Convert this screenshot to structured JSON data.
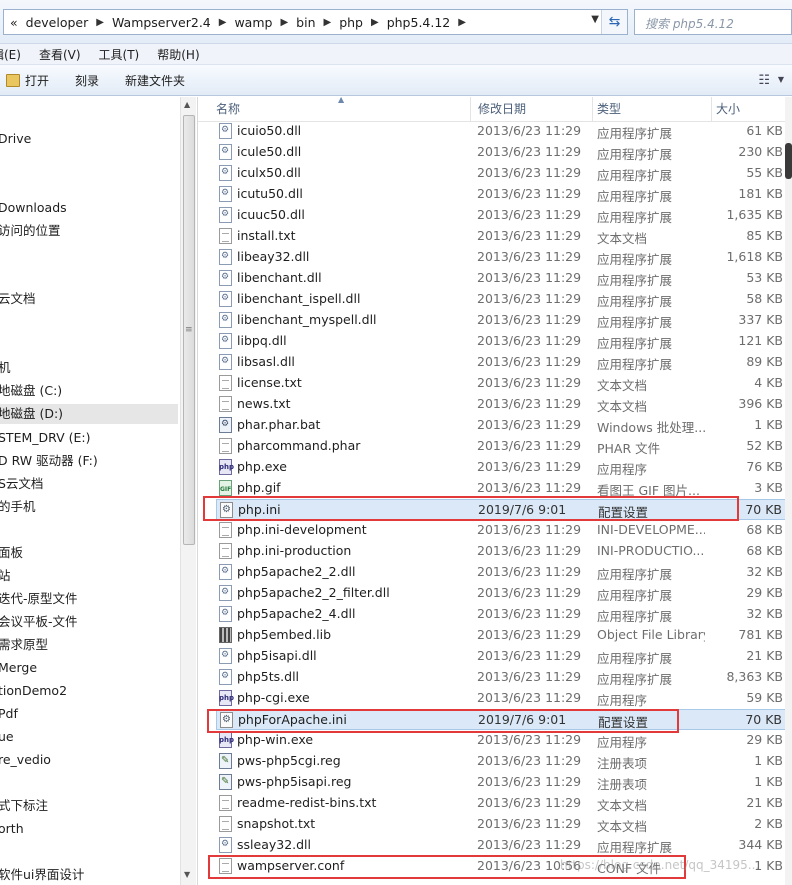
{
  "address_bar": {
    "crumbs": [
      "developer",
      "Wampserver2.4",
      "wamp",
      "bin",
      "php",
      "php5.4.12"
    ],
    "search_placeholder": "搜索 php5.4.12"
  },
  "menu": [
    "辑(E)",
    "查看(V)",
    "工具(T)",
    "帮助(H)"
  ],
  "toolbar": {
    "open": "打开",
    "burn": "刻录",
    "new_folder": "新建文件夹"
  },
  "nav_items": [
    "Drive",
    "Downloads",
    "访问的位置",
    "云文档",
    "机",
    "地磁盘 (C:)",
    "地磁盘 (D:)",
    "STEM_DRV (E:)",
    "D RW 驱动器 (F:)",
    "S云文档",
    "的手机",
    "面板",
    "站",
    "迭代-原型文件",
    "会议平板-文件",
    "需求原型",
    "Merge",
    "tionDemo2",
    "Pdf",
    "ue",
    "re_vedio",
    "式下标注",
    "orth",
    "软件ui界面设计"
  ],
  "columns": {
    "name": "名称",
    "date": "修改日期",
    "type": "类型",
    "size": "大小"
  },
  "files": [
    {
      "name": "icuio50.dll",
      "date": "2013/6/23 11:29",
      "type": "应用程序扩展",
      "size": "61 KB",
      "icon": "dll-icon"
    },
    {
      "name": "icule50.dll",
      "date": "2013/6/23 11:29",
      "type": "应用程序扩展",
      "size": "230 KB",
      "icon": "dll-icon"
    },
    {
      "name": "iculx50.dll",
      "date": "2013/6/23 11:29",
      "type": "应用程序扩展",
      "size": "55 KB",
      "icon": "dll-icon"
    },
    {
      "name": "icutu50.dll",
      "date": "2013/6/23 11:29",
      "type": "应用程序扩展",
      "size": "181 KB",
      "icon": "dll-icon"
    },
    {
      "name": "icuuc50.dll",
      "date": "2013/6/23 11:29",
      "type": "应用程序扩展",
      "size": "1,635 KB",
      "icon": "dll-icon"
    },
    {
      "name": "install.txt",
      "date": "2013/6/23 11:29",
      "type": "文本文档",
      "size": "85 KB",
      "icon": "txt-icon"
    },
    {
      "name": "libeay32.dll",
      "date": "2013/6/23 11:29",
      "type": "应用程序扩展",
      "size": "1,618 KB",
      "icon": "dll-icon"
    },
    {
      "name": "libenchant.dll",
      "date": "2013/6/23 11:29",
      "type": "应用程序扩展",
      "size": "53 KB",
      "icon": "dll-icon"
    },
    {
      "name": "libenchant_ispell.dll",
      "date": "2013/6/23 11:29",
      "type": "应用程序扩展",
      "size": "58 KB",
      "icon": "dll-icon"
    },
    {
      "name": "libenchant_myspell.dll",
      "date": "2013/6/23 11:29",
      "type": "应用程序扩展",
      "size": "337 KB",
      "icon": "dll-icon"
    },
    {
      "name": "libpq.dll",
      "date": "2013/6/23 11:29",
      "type": "应用程序扩展",
      "size": "121 KB",
      "icon": "dll-icon"
    },
    {
      "name": "libsasl.dll",
      "date": "2013/6/23 11:29",
      "type": "应用程序扩展",
      "size": "89 KB",
      "icon": "dll-icon"
    },
    {
      "name": "license.txt",
      "date": "2013/6/23 11:29",
      "type": "文本文档",
      "size": "4 KB",
      "icon": "txt-icon"
    },
    {
      "name": "news.txt",
      "date": "2013/6/23 11:29",
      "type": "文本文档",
      "size": "396 KB",
      "icon": "txt-icon"
    },
    {
      "name": "phar.phar.bat",
      "date": "2013/6/23 11:29",
      "type": "Windows 批处理...",
      "size": "1 KB",
      "icon": "bat-icon"
    },
    {
      "name": "pharcommand.phar",
      "date": "2013/6/23 11:29",
      "type": "PHAR 文件",
      "size": "52 KB",
      "icon": "txt-icon"
    },
    {
      "name": "php.exe",
      "date": "2013/6/23 11:29",
      "type": "应用程序",
      "size": "76 KB",
      "icon": "php-icon"
    },
    {
      "name": "php.gif",
      "date": "2013/6/23 11:29",
      "type": "看图王 GIF 图片...",
      "size": "3 KB",
      "icon": "gif-icon"
    },
    {
      "name": "php.ini",
      "date": "2019/7/6 9:01",
      "type": "配置设置",
      "size": "70 KB",
      "icon": "ini-icon",
      "highlight": true
    },
    {
      "name": "php.ini-development",
      "date": "2013/6/23 11:29",
      "type": "INI-DEVELOPME...",
      "size": "68 KB",
      "icon": "txt-icon"
    },
    {
      "name": "php.ini-production",
      "date": "2013/6/23 11:29",
      "type": "INI-PRODUCTIO...",
      "size": "68 KB",
      "icon": "txt-icon"
    },
    {
      "name": "php5apache2_2.dll",
      "date": "2013/6/23 11:29",
      "type": "应用程序扩展",
      "size": "32 KB",
      "icon": "dll-icon"
    },
    {
      "name": "php5apache2_2_filter.dll",
      "date": "2013/6/23 11:29",
      "type": "应用程序扩展",
      "size": "29 KB",
      "icon": "dll-icon"
    },
    {
      "name": "php5apache2_4.dll",
      "date": "2013/6/23 11:29",
      "type": "应用程序扩展",
      "size": "32 KB",
      "icon": "dll-icon"
    },
    {
      "name": "php5embed.lib",
      "date": "2013/6/23 11:29",
      "type": "Object File Library",
      "size": "781 KB",
      "icon": "lib-icon"
    },
    {
      "name": "php5isapi.dll",
      "date": "2013/6/23 11:29",
      "type": "应用程序扩展",
      "size": "21 KB",
      "icon": "dll-icon"
    },
    {
      "name": "php5ts.dll",
      "date": "2013/6/23 11:29",
      "type": "应用程序扩展",
      "size": "8,363 KB",
      "icon": "dll-icon"
    },
    {
      "name": "php-cgi.exe",
      "date": "2013/6/23 11:29",
      "type": "应用程序",
      "size": "59 KB",
      "icon": "php-icon"
    },
    {
      "name": "phpForApache.ini",
      "date": "2019/7/6 9:01",
      "type": "配置设置",
      "size": "70 KB",
      "icon": "ini-icon",
      "highlight": true
    },
    {
      "name": "php-win.exe",
      "date": "2013/6/23 11:29",
      "type": "应用程序",
      "size": "29 KB",
      "icon": "php-icon"
    },
    {
      "name": "pws-php5cgi.reg",
      "date": "2013/6/23 11:29",
      "type": "注册表项",
      "size": "1 KB",
      "icon": "reg-icon"
    },
    {
      "name": "pws-php5isapi.reg",
      "date": "2013/6/23 11:29",
      "type": "注册表项",
      "size": "1 KB",
      "icon": "reg-icon"
    },
    {
      "name": "readme-redist-bins.txt",
      "date": "2013/6/23 11:29",
      "type": "文本文档",
      "size": "21 KB",
      "icon": "txt-icon"
    },
    {
      "name": "snapshot.txt",
      "date": "2013/6/23 11:29",
      "type": "文本文档",
      "size": "2 KB",
      "icon": "txt-icon"
    },
    {
      "name": "ssleay32.dll",
      "date": "2013/6/23 11:29",
      "type": "应用程序扩展",
      "size": "344 KB",
      "icon": "dll-icon"
    },
    {
      "name": "wampserver.conf",
      "date": "2013/6/23 10:56",
      "type": "CONF 文件",
      "size": "1 KB",
      "icon": "txt-icon"
    }
  ],
  "watermark": "https://blog.csdn.net/qq_34195..."
}
